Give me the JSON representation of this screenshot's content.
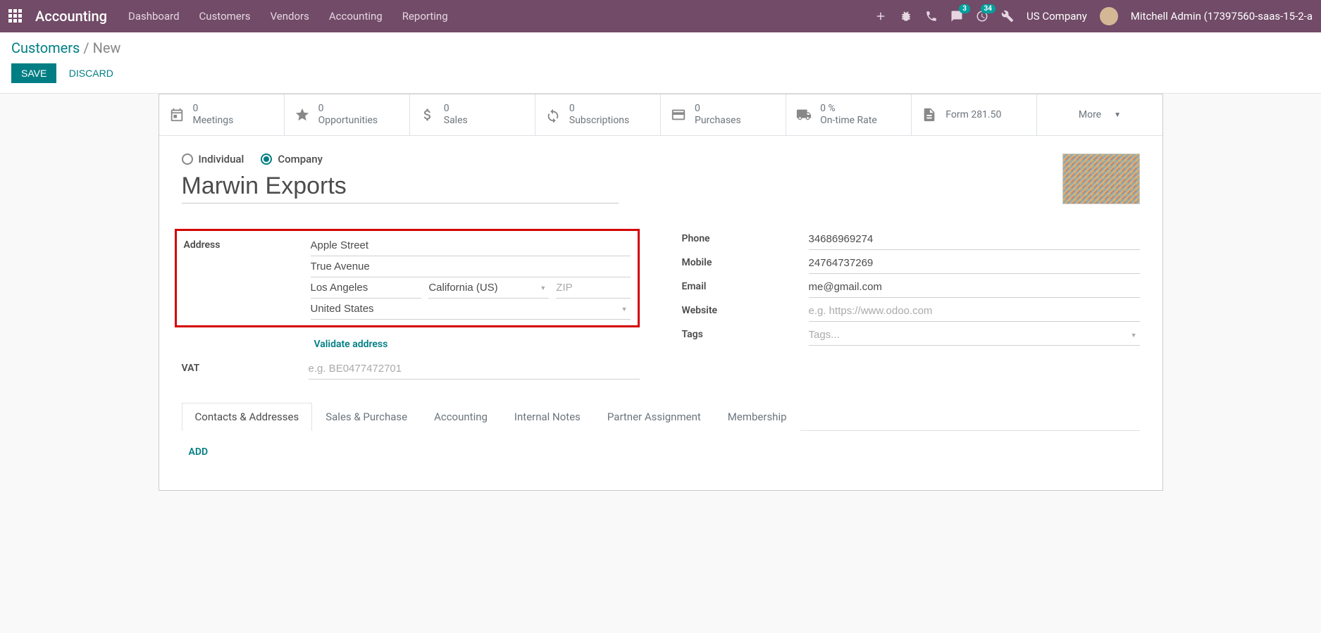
{
  "nav": {
    "brand": "Accounting",
    "menu": [
      "Dashboard",
      "Customers",
      "Vendors",
      "Accounting",
      "Reporting"
    ],
    "messaging_badge": "3",
    "activity_badge": "34",
    "company": "US Company",
    "user": "Mitchell Admin (17397560-saas-15-2-a"
  },
  "breadcrumb": {
    "parent": "Customers",
    "current": "New"
  },
  "buttons": {
    "save": "Save",
    "discard": "Discard"
  },
  "stats": {
    "meetings": {
      "val": "0",
      "label": "Meetings"
    },
    "opps": {
      "val": "0",
      "label": "Opportunities"
    },
    "sales": {
      "val": "0",
      "label": "Sales"
    },
    "subs": {
      "val": "0",
      "label": "Subscriptions"
    },
    "purchases": {
      "val": "0",
      "label": "Purchases"
    },
    "ontime": {
      "val": "0 %",
      "label": "On-time Rate"
    },
    "form281": {
      "label": "Form 281.50"
    },
    "more": "More"
  },
  "type": {
    "individual": "Individual",
    "company": "Company"
  },
  "name": "Marwin Exports",
  "labels": {
    "address": "Address",
    "vat": "VAT",
    "phone": "Phone",
    "mobile": "Mobile",
    "email": "Email",
    "website": "Website",
    "tags": "Tags"
  },
  "address": {
    "street": "Apple Street",
    "street2": "True Avenue",
    "city": "Los Angeles",
    "state": "California (US)",
    "zip_placeholder": "ZIP",
    "country": "United States"
  },
  "validate": "Validate address",
  "vat_placeholder": "e.g. BE0477472701",
  "contact": {
    "phone": "34686969274",
    "mobile": "24764737269",
    "email": "me@gmail.com",
    "website_placeholder": "e.g. https://www.odoo.com",
    "tags_placeholder": "Tags..."
  },
  "tabs": [
    "Contacts & Addresses",
    "Sales & Purchase",
    "Accounting",
    "Internal Notes",
    "Partner Assignment",
    "Membership"
  ],
  "add": "Add"
}
